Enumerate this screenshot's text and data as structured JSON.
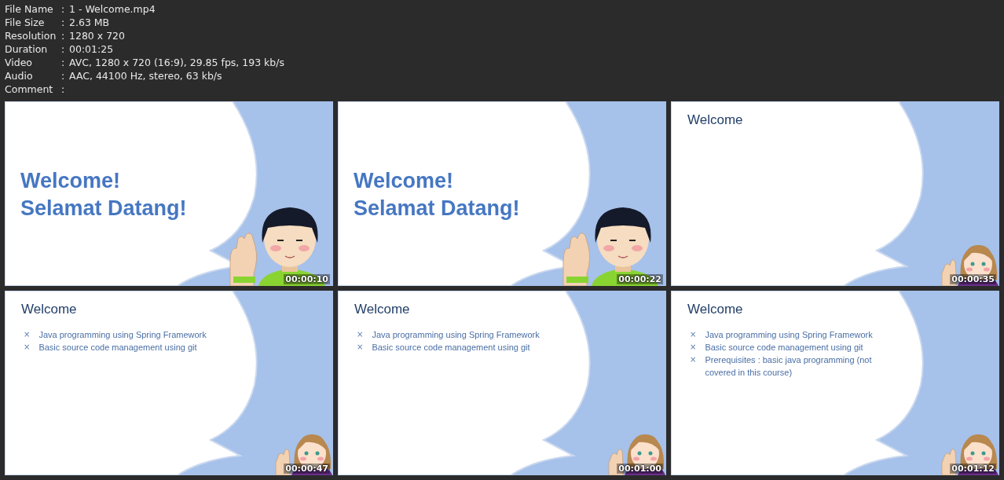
{
  "info": [
    {
      "label": "File Name",
      "value": "1 - Welcome.mp4"
    },
    {
      "label": "File Size",
      "value": "2.63 MB"
    },
    {
      "label": "Resolution",
      "value": "1280 x 720"
    },
    {
      "label": "Duration",
      "value": "00:01:25"
    },
    {
      "label": "Video",
      "value": "AVC, 1280 x 720 (16:9), 29.85 fps, 193 kb/s"
    },
    {
      "label": "Audio",
      "value": "AAC, 44100 Hz, stereo, 63 kb/s"
    },
    {
      "label": "Comment"
    }
  ],
  "separator": ":",
  "frames": [
    {
      "kind": "title",
      "lines": [
        "Welcome!",
        "Selamat Datang!"
      ],
      "time": "00:00:10"
    },
    {
      "kind": "title",
      "lines": [
        "Welcome!",
        "Selamat Datang!"
      ],
      "time": "00:00:22"
    },
    {
      "kind": "heading",
      "heading": "Welcome",
      "time": "00:00:35"
    },
    {
      "kind": "heading",
      "heading": "Welcome",
      "bullets": [
        {
          "marker": "×",
          "text": "Java programming using Spring Framework"
        },
        {
          "marker": "×",
          "text": "Basic source code management using git"
        }
      ],
      "time": "00:00:47"
    },
    {
      "kind": "heading",
      "heading": "Welcome",
      "bullets": [
        {
          "marker": "×",
          "text": "Java programming using Spring Framework"
        },
        {
          "marker": "×",
          "text": "Basic source code management using git"
        }
      ],
      "time": "00:01:00"
    },
    {
      "kind": "heading",
      "heading": "Welcome",
      "bullets": [
        {
          "marker": "×",
          "text": "Java programming using Spring Framework"
        },
        {
          "marker": "×",
          "text": "Basic source code management using git"
        },
        {
          "marker": "×",
          "text": "Prerequisites : basic java programming (not covered in this course)"
        }
      ],
      "time": "00:01:12"
    }
  ]
}
